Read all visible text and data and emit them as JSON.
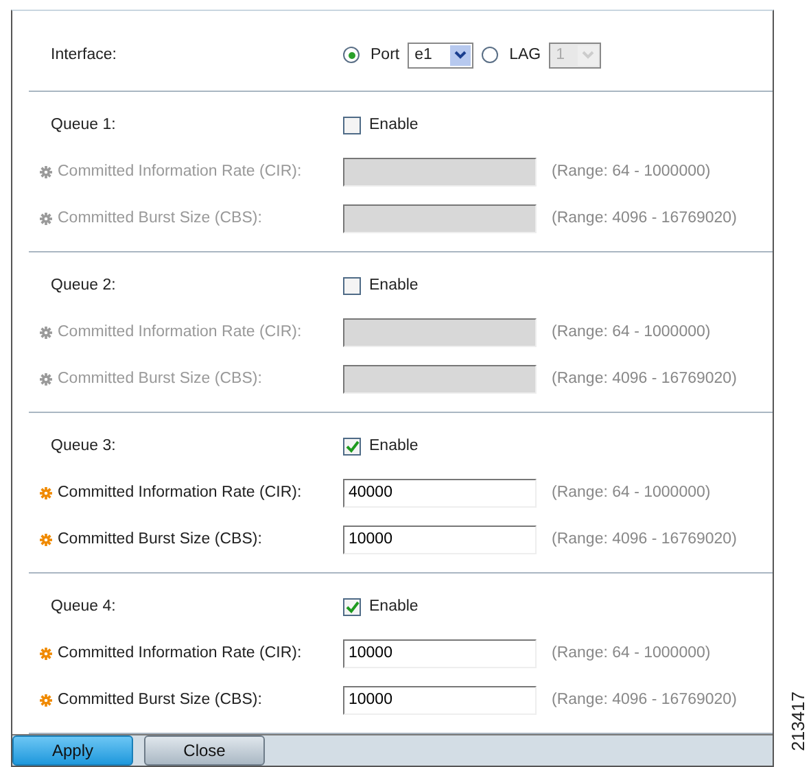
{
  "interface": {
    "label": "Interface:",
    "options": [
      {
        "label": "Port",
        "selected": true,
        "value": "e1"
      },
      {
        "label": "LAG",
        "selected": false,
        "value": "1"
      }
    ]
  },
  "queues": [
    {
      "label": "Queue 1:",
      "enable_label": "Enable",
      "checked": false,
      "fields": [
        {
          "label": "Committed Information Rate (CIR):",
          "range": "(Range: 64 - 1000000)"
        },
        {
          "label": "Committed Burst Size (CBS):",
          "range": "(Range: 4096 - 16769020)"
        }
      ]
    },
    {
      "label": "Queue 2:",
      "enable_label": "Enable",
      "checked": false,
      "fields": [
        {
          "label": "Committed Information Rate (CIR):",
          "range": "(Range: 64 - 1000000)"
        },
        {
          "label": "Committed Burst Size (CBS):",
          "range": "(Range: 4096 - 16769020)"
        }
      ]
    },
    {
      "label": "Queue 3:",
      "enable_label": "Enable",
      "checked": true,
      "fields": [
        {
          "label": "Committed Information Rate (CIR):",
          "value": "40000",
          "range": "(Range: 64 - 1000000)"
        },
        {
          "label": "Committed Burst Size (CBS):",
          "value": "10000",
          "range": "(Range: 4096 - 16769020)"
        }
      ]
    },
    {
      "label": "Queue 4:",
      "enable_label": "Enable",
      "checked": true,
      "fields": [
        {
          "label": "Committed Information Rate (CIR):",
          "value": "10000",
          "range": "(Range: 64 - 1000000)"
        },
        {
          "label": "Committed Burst Size (CBS):",
          "value": "10000",
          "range": "(Range: 4096 - 16769020)"
        }
      ]
    }
  ],
  "buttons": [
    {
      "label": "Apply",
      "kind": "primary"
    },
    {
      "label": "Close",
      "kind": "secondary"
    }
  ],
  "figure_id": "213417"
}
